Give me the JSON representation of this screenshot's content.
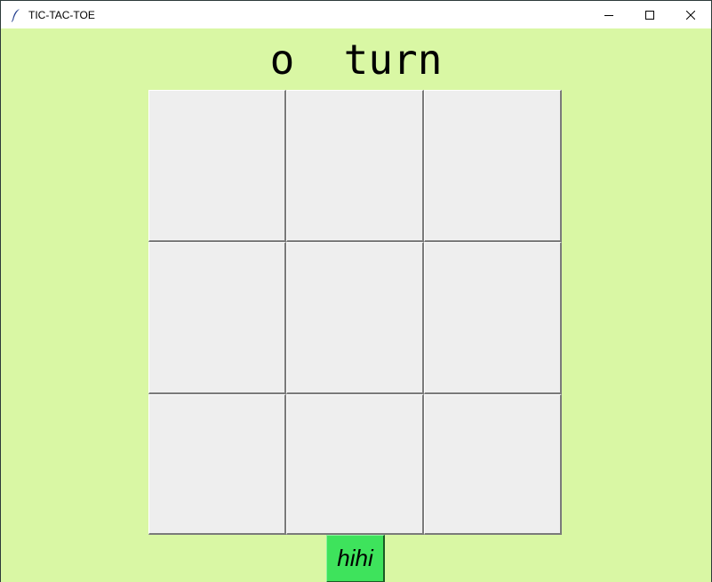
{
  "window": {
    "title": "TIC-TAC-TOE",
    "icon": "feather-icon",
    "controls": [
      "minimize-icon",
      "maximize-icon",
      "close-icon"
    ]
  },
  "game": {
    "status": "o  turn",
    "board": [
      "",
      "",
      "",
      "",
      "",
      "",
      "",
      "",
      ""
    ]
  },
  "restart": {
    "label": "hihi"
  },
  "colors": {
    "background": "#d9f7a4",
    "cell": "#eeeeee",
    "button": "#3ee35c"
  }
}
